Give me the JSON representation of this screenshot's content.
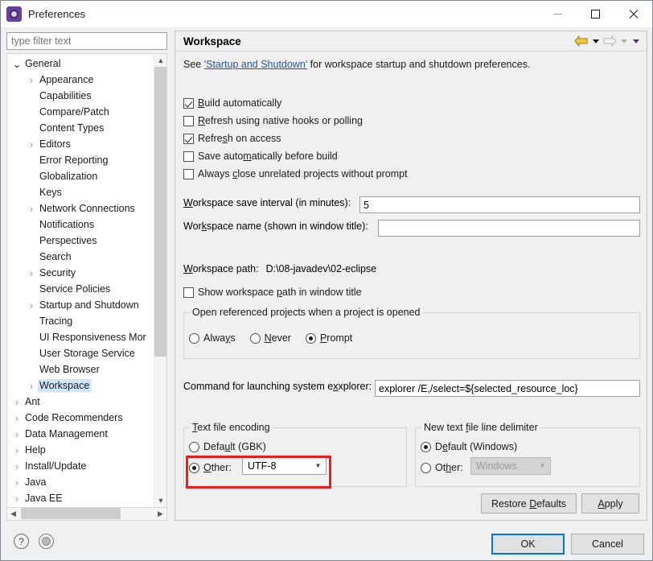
{
  "window": {
    "title": "Preferences",
    "icon": "gear-icon",
    "controls": {
      "minimize": "—",
      "maximize": "□",
      "close": "✕"
    }
  },
  "sidebar": {
    "filter_placeholder": "type filter text",
    "filter_value": "",
    "items": [
      {
        "label": "General",
        "level": 0,
        "arrow": "open",
        "selected": false
      },
      {
        "label": "Appearance",
        "level": 1,
        "arrow": "collapsed",
        "selected": false
      },
      {
        "label": "Capabilities",
        "level": 1,
        "arrow": "none",
        "selected": false
      },
      {
        "label": "Compare/Patch",
        "level": 1,
        "arrow": "none",
        "selected": false
      },
      {
        "label": "Content Types",
        "level": 1,
        "arrow": "none",
        "selected": false
      },
      {
        "label": "Editors",
        "level": 1,
        "arrow": "collapsed",
        "selected": false
      },
      {
        "label": "Error Reporting",
        "level": 1,
        "arrow": "none",
        "selected": false
      },
      {
        "label": "Globalization",
        "level": 1,
        "arrow": "none",
        "selected": false
      },
      {
        "label": "Keys",
        "level": 1,
        "arrow": "none",
        "selected": false
      },
      {
        "label": "Network Connections",
        "level": 1,
        "arrow": "collapsed",
        "selected": false
      },
      {
        "label": "Notifications",
        "level": 1,
        "arrow": "none",
        "selected": false
      },
      {
        "label": "Perspectives",
        "level": 1,
        "arrow": "none",
        "selected": false
      },
      {
        "label": "Search",
        "level": 1,
        "arrow": "none",
        "selected": false
      },
      {
        "label": "Security",
        "level": 1,
        "arrow": "collapsed",
        "selected": false
      },
      {
        "label": "Service Policies",
        "level": 1,
        "arrow": "none",
        "selected": false
      },
      {
        "label": "Startup and Shutdown",
        "level": 1,
        "arrow": "collapsed",
        "selected": false
      },
      {
        "label": "Tracing",
        "level": 1,
        "arrow": "none",
        "selected": false
      },
      {
        "label": "UI Responsiveness Mor",
        "level": 1,
        "arrow": "none",
        "selected": false
      },
      {
        "label": "User Storage Service",
        "level": 1,
        "arrow": "none",
        "selected": false
      },
      {
        "label": "Web Browser",
        "level": 1,
        "arrow": "none",
        "selected": false
      },
      {
        "label": "Workspace",
        "level": 1,
        "arrow": "collapsed",
        "selected": true
      },
      {
        "label": "Ant",
        "level": 0,
        "arrow": "collapsed",
        "selected": false
      },
      {
        "label": "Code Recommenders",
        "level": 0,
        "arrow": "collapsed",
        "selected": false
      },
      {
        "label": "Data Management",
        "level": 0,
        "arrow": "collapsed",
        "selected": false
      },
      {
        "label": "Help",
        "level": 0,
        "arrow": "collapsed",
        "selected": false
      },
      {
        "label": "Install/Update",
        "level": 0,
        "arrow": "collapsed",
        "selected": false
      },
      {
        "label": "Java",
        "level": 0,
        "arrow": "collapsed",
        "selected": false
      },
      {
        "label": "Java EE",
        "level": 0,
        "arrow": "collapsed",
        "selected": false
      }
    ]
  },
  "panel": {
    "title": "Workspace",
    "nav": {
      "back": "back-arrow-icon",
      "forward": "forward-arrow-icon",
      "menu": "dropdown-arrow-icon"
    },
    "description": {
      "before": "See ",
      "link": "'Startup and Shutdown'",
      "after": " for workspace startup and shutdown preferences."
    },
    "checkboxes": [
      {
        "label": "Build automatically",
        "mnemonic": "B",
        "checked": true
      },
      {
        "label": "Refresh using native hooks or polling",
        "mnemonic": "R",
        "checked": false
      },
      {
        "label": "Refresh on access",
        "mnemonic": "s",
        "checked": true
      },
      {
        "label": "Save automatically before build",
        "mnemonic": "m",
        "checked": false
      },
      {
        "label": "Always close unrelated projects without prompt",
        "mnemonic": "c",
        "checked": false
      }
    ],
    "save_interval": {
      "label": "Workspace save interval (in minutes):",
      "value": "5"
    },
    "workspace_name": {
      "label": "Workspace name (shown in window title):",
      "value": ""
    },
    "workspace_path": {
      "label": "Workspace path:",
      "value": "D:\\08-javadev\\02-eclipse"
    },
    "show_path": {
      "label": "Show workspace path in window title",
      "checked": false
    },
    "referenced_projects": {
      "group_title": "Open referenced projects when a project is opened",
      "options": [
        {
          "label": "Always",
          "selected": false
        },
        {
          "label": "Never",
          "selected": false
        },
        {
          "label": "Prompt",
          "selected": true
        }
      ]
    },
    "explorer_command": {
      "label": "Command for launching system explorer:",
      "value": "explorer /E,/select=${selected_resource_loc}"
    },
    "text_file_encoding": {
      "group_title": "Text file encoding",
      "default_option": {
        "label": "Default (GBK)",
        "selected": false
      },
      "other_option": {
        "label": "Other:",
        "selected": true
      },
      "other_value": "UTF-8"
    },
    "line_delimiter": {
      "group_title": "New text file line delimiter",
      "default_option": {
        "label": "Default (Windows)",
        "selected": true
      },
      "other_option": {
        "label": "Other:",
        "selected": false
      },
      "other_value": "Windows",
      "other_disabled": true
    },
    "restore_defaults_label": "Restore Defaults",
    "apply_label": "Apply"
  },
  "footer": {
    "help_icon": "?",
    "secondary_icon": "pin-icon",
    "ok_label": "OK",
    "cancel_label": "Cancel"
  },
  "annotation": {
    "color": "#ef1c1c",
    "target": "text-file-encoding-other-row"
  }
}
